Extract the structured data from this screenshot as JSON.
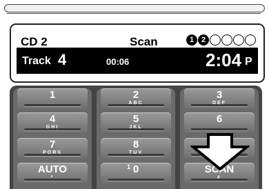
{
  "display": {
    "disc": "CD 2",
    "mode": "Scan",
    "disc_slots": [
      "1",
      "2",
      "",
      "",
      "",
      ""
    ],
    "track_label": "Track",
    "track_number": "4",
    "elapsed": "00:06",
    "clock": "2:04",
    "clock_suffix": "P"
  },
  "keypad": {
    "keys": [
      {
        "main": "1",
        "sub": ""
      },
      {
        "main": "2",
        "sub": "ABC"
      },
      {
        "main": "3",
        "sub": "DEF"
      },
      {
        "main": "4",
        "sub": "GHI"
      },
      {
        "main": "5",
        "sub": "JKL"
      },
      {
        "main": "6",
        "sub": ""
      },
      {
        "main": "7",
        "sub": "PQRS"
      },
      {
        "main": "8",
        "sub": "TUV"
      },
      {
        "main": "",
        "sub": ""
      },
      {
        "main": "AUTO",
        "sub": "*"
      },
      {
        "main": "0",
        "sub": "",
        "sup": "1"
      },
      {
        "main": "SCAN",
        "sub": "#"
      }
    ]
  },
  "colors": {
    "lcd_background": "#000000",
    "keypad_body": "#444444",
    "key_face": "#888888"
  },
  "icons": {
    "arrow": "down-arrow-callout-icon"
  }
}
